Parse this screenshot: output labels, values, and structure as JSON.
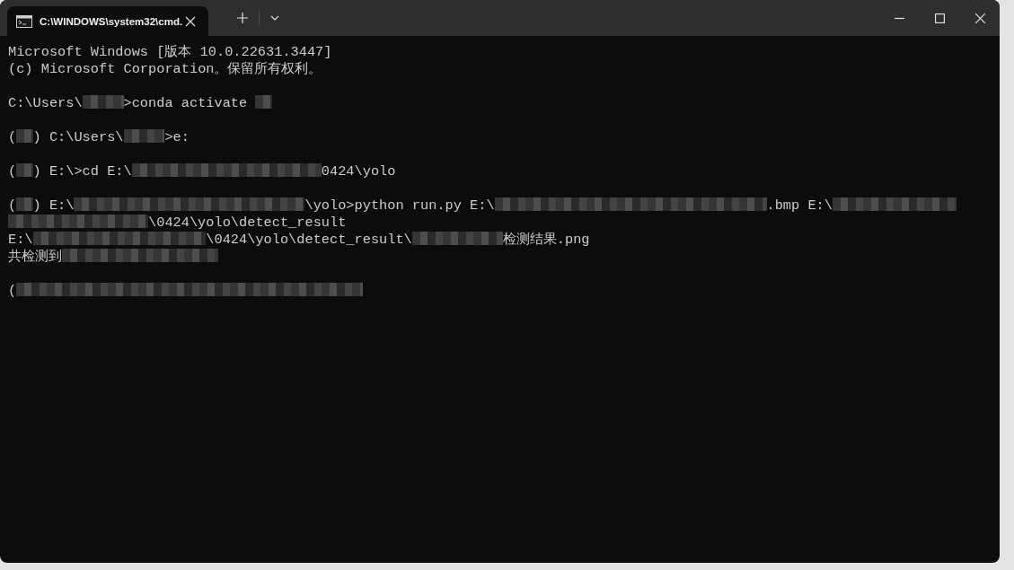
{
  "window": {
    "tab": {
      "title": "C:\\WINDOWS\\system32\\cmd.",
      "selected": true
    }
  },
  "lines": [
    {
      "kind": "output",
      "segments": [
        {
          "kind": "text",
          "text": "Microsoft Windows [版本 10.0.22631.3447]"
        }
      ]
    },
    {
      "kind": "output",
      "segments": [
        {
          "kind": "text",
          "text": "(c) Microsoft Corporation。保留所有权利。"
        }
      ]
    },
    {
      "kind": "blank"
    },
    {
      "kind": "output",
      "segments": [
        {
          "kind": "text",
          "text": "C:\\Users\\"
        },
        {
          "kind": "redacted"
        },
        {
          "kind": "text",
          "text": ">conda activate "
        },
        {
          "kind": "redacted"
        }
      ]
    },
    {
      "kind": "blank"
    },
    {
      "kind": "output",
      "segments": [
        {
          "kind": "text",
          "text": "("
        },
        {
          "kind": "redacted"
        },
        {
          "kind": "text",
          "text": ") C:\\Users\\"
        },
        {
          "kind": "redacted"
        },
        {
          "kind": "text",
          "text": ">e:"
        }
      ]
    },
    {
      "kind": "blank"
    },
    {
      "kind": "output",
      "segments": [
        {
          "kind": "text",
          "text": "("
        },
        {
          "kind": "redacted"
        },
        {
          "kind": "text",
          "text": ") E:\\>cd E:\\"
        },
        {
          "kind": "redacted"
        },
        {
          "kind": "text",
          "text": "0424\\yolo"
        }
      ]
    },
    {
      "kind": "blank"
    },
    {
      "kind": "output",
      "segments": [
        {
          "kind": "text",
          "text": "("
        },
        {
          "kind": "redacted"
        },
        {
          "kind": "text",
          "text": ") E:\\"
        },
        {
          "kind": "redacted"
        },
        {
          "kind": "text",
          "text": "\\yolo>python run.py E:\\"
        },
        {
          "kind": "redacted"
        },
        {
          "kind": "text",
          "text": ".bmp E:\\"
        },
        {
          "kind": "redacted"
        }
      ]
    },
    {
      "kind": "output",
      "segments": [
        {
          "kind": "redacted"
        },
        {
          "kind": "text",
          "text": "\\0424\\yolo\\detect_result"
        }
      ]
    },
    {
      "kind": "output",
      "segments": [
        {
          "kind": "text",
          "text": "E:\\"
        },
        {
          "kind": "redacted"
        },
        {
          "kind": "text",
          "text": "\\0424\\yolo\\detect_result\\"
        },
        {
          "kind": "redacted"
        },
        {
          "kind": "text",
          "text": "检测结果.png"
        }
      ]
    },
    {
      "kind": "output",
      "segments": [
        {
          "kind": "text",
          "text": "共检测到"
        },
        {
          "kind": "redacted"
        }
      ]
    },
    {
      "kind": "blank"
    },
    {
      "kind": "output",
      "segments": [
        {
          "kind": "text",
          "text": "("
        },
        {
          "kind": "redacted"
        }
      ]
    }
  ]
}
